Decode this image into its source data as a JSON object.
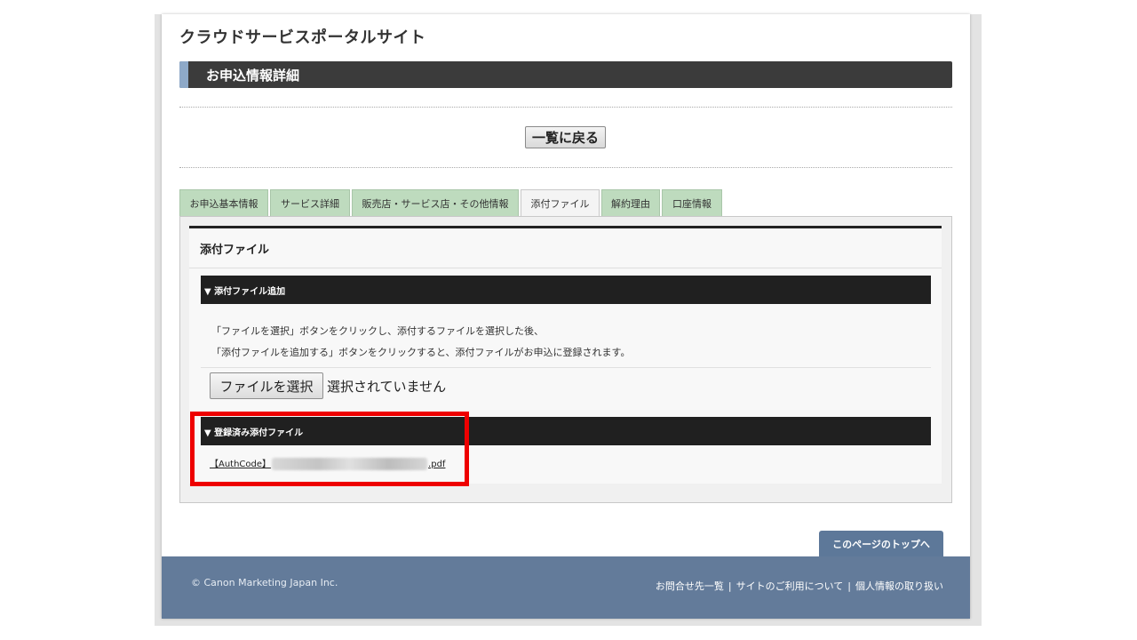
{
  "site": {
    "title": "クラウドサービスポータルサイト"
  },
  "section": {
    "title": "お申込情報詳細"
  },
  "back_button": "一覧に戻る",
  "tabs": [
    {
      "label": "お申込基本情報"
    },
    {
      "label": "サービス詳細"
    },
    {
      "label": "販売店・サービス店・その他情報"
    },
    {
      "label": "添付ファイル",
      "active": true
    },
    {
      "label": "解約理由"
    },
    {
      "label": "口座情報"
    }
  ],
  "panel": {
    "title": "添付ファイル",
    "add_section": {
      "label": "▼ 添付ファイル追加",
      "instruction_line1": "「ファイルを選択」ボタンをクリックし、添付するファイルを選択した後、",
      "instruction_line2": "「添付ファイルを追加する」ボタンをクリックすると、添付ファイルがお申込に登録されます。",
      "file_button": "ファイルを選択",
      "file_status": "選択されていません"
    },
    "registered_section": {
      "label": "▼ 登録済み添付ファイル",
      "file_prefix": "【AuthCode】",
      "file_suffix": ".pdf"
    }
  },
  "colors": {
    "highlight": "#ee0000",
    "tab_bg": "#bedbbe",
    "footer": "#637b9a",
    "header_bar": "#3b3b3b"
  },
  "page_top_button": "このページのトップへ",
  "footer": {
    "copyright": "© Canon Marketing Japan Inc.",
    "links": [
      "お問合せ先一覧",
      "サイトのご利用について",
      "個人情報の取り扱い"
    ],
    "separator": "|"
  }
}
